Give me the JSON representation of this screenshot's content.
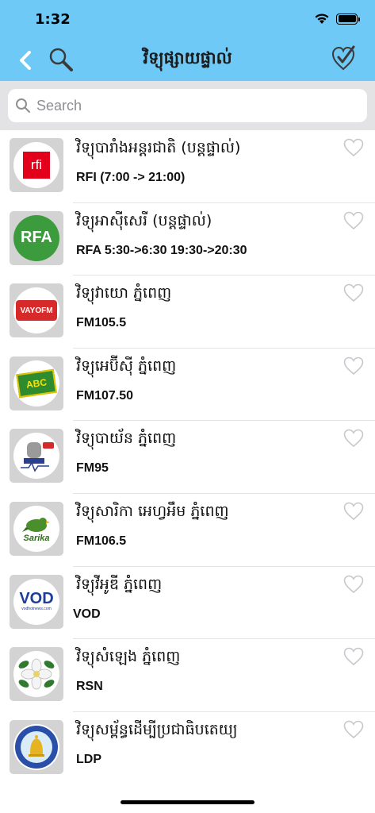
{
  "status_bar": {
    "time": "1:32"
  },
  "nav": {
    "title": "វិទ្យុផ្សាយផ្ទាល់",
    "back_icon": "chevron-left-icon",
    "search_icon": "magnifier-icon",
    "check_icon": "heart-check-icon"
  },
  "search": {
    "placeholder": "Search"
  },
  "stations": [
    {
      "title": "វិទ្យុបារាំងអន្តរជាតិ (បន្តផ្ទាល់)",
      "subtitle": "RFI (7:00 -> 21:00)",
      "logo": "rfi-logo"
    },
    {
      "title": "វិទ្យុអាស៊ីសេរី (បន្តផ្ទាល់)",
      "subtitle": "RFA 5:30->6:30  19:30->20:30",
      "logo": "rfa-logo"
    },
    {
      "title": "វិទ្យុវាយោ ភ្នំពេញ",
      "subtitle": "FM105.5",
      "logo": "vayo-logo"
    },
    {
      "title": "វិទ្យុអេប៊ីស៊ី ភ្នំពេញ",
      "subtitle": "FM107.50",
      "logo": "abc-logo"
    },
    {
      "title": "វិទ្យុបាយ័ន ភ្នំពេញ",
      "subtitle": "FM95",
      "logo": "bayon-logo"
    },
    {
      "title": "វិទ្យុសារិកា អេហ្វអឹម ភ្នំពេញ",
      "subtitle": "FM106.5",
      "logo": "sarika-logo"
    },
    {
      "title": "វិទ្យុវីអូឌី ភ្នំពេញ",
      "subtitle": "VOD",
      "logo": "vod-logo"
    },
    {
      "title": "វិទ្យុសំឡេង ភ្នំពេញ",
      "subtitle": "RSN",
      "logo": "rsn-logo"
    },
    {
      "title": "វិទ្យុសម្ព័ន្ធដើម្បីប្រជាធិបតេយ្យ",
      "subtitle": "LDP",
      "logo": "ldp-logo"
    }
  ],
  "logo_text": {
    "rfi": "rfi",
    "rfa": "RFA",
    "vayo": "VAYOFM",
    "abc": "ABC",
    "vod": "VOD",
    "vod_site": "vodhotnews.com",
    "sarika": "Sarika"
  },
  "colors": {
    "nav_background": "#6ec9f7",
    "rfi_red": "#e2001a",
    "rfa_green": "#3c9b3c",
    "vayo_red": "#d62a2a",
    "heart_outline": "#c7c7cc"
  }
}
